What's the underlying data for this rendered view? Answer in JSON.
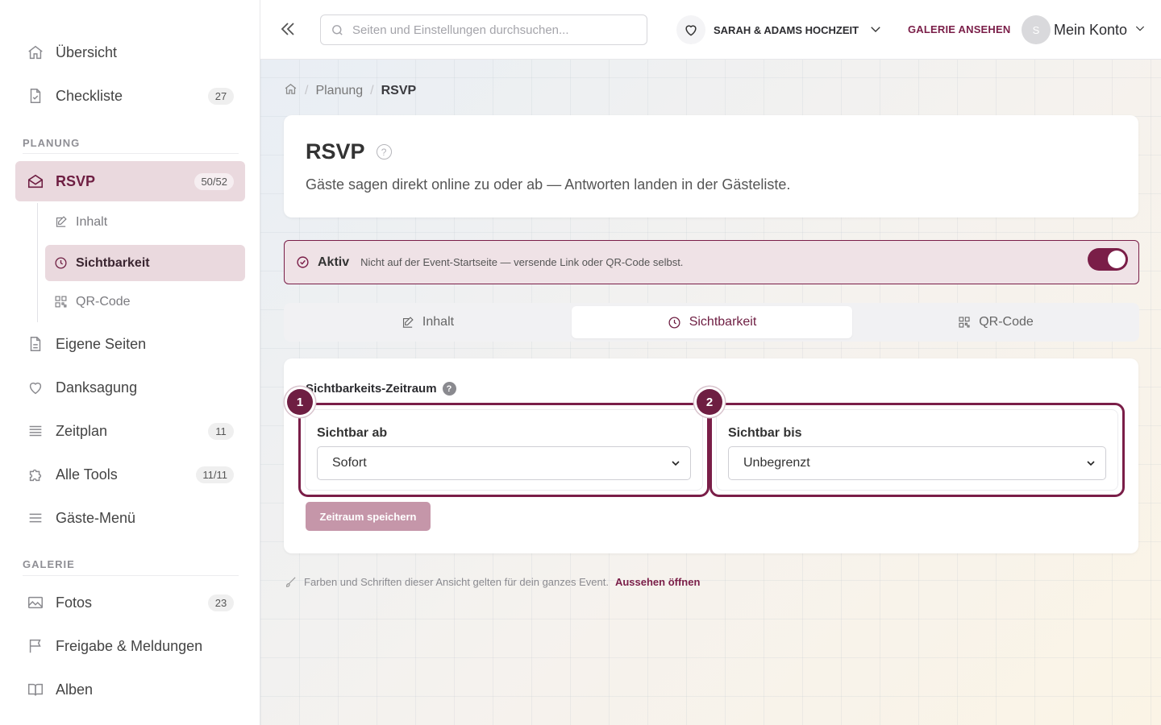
{
  "sidebar": {
    "overview": {
      "label": "Übersicht"
    },
    "checklist": {
      "label": "Checkliste",
      "badge": "27"
    },
    "section_planning": "PLANUNG",
    "rsvp": {
      "label": "RSVP",
      "badge": "50/52"
    },
    "rsvp_sub": {
      "content": "Inhalt",
      "visibility": "Sichtbarkeit",
      "qrcode": "QR-Code"
    },
    "custom_pages": {
      "label": "Eigene Seiten"
    },
    "thanks": {
      "label": "Danksagung"
    },
    "schedule": {
      "label": "Zeitplan",
      "badge": "11"
    },
    "all_tools": {
      "label": "Alle Tools",
      "badge": "11/11"
    },
    "guest_menu": {
      "label": "Gäste-Menü"
    },
    "section_gallery": "GALERIE",
    "photos": {
      "label": "Fotos",
      "badge": "23"
    },
    "approval": {
      "label": "Freigabe & Meldungen"
    },
    "albums": {
      "label": "Alben"
    }
  },
  "topbar": {
    "search_placeholder": "Seiten und Einstellungen durchsuchen...",
    "event_name": "SARAH & ADAMS HOCHZEIT",
    "gallery_link": "GALERIE ANSEHEN",
    "avatar_initial": "S",
    "account_label": "Mein Konto"
  },
  "breadcrumb": {
    "level1": "Planung",
    "current": "RSVP"
  },
  "header": {
    "title": "RSVP",
    "description": "Gäste sagen direkt online zu oder ab — Antworten landen in der Gästeliste."
  },
  "status": {
    "label": "Aktiv",
    "text": "Nicht auf der Event-Startseite — versende Link oder QR-Code selbst.",
    "enabled": true
  },
  "tabs": {
    "content": "Inhalt",
    "visibility": "Sichtbarkeit",
    "qrcode": "QR-Code"
  },
  "visibility": {
    "section_title": "Sichtbarkeits-Zeitraum",
    "help": "?",
    "from": {
      "step": "1",
      "label": "Sichtbar ab",
      "value": "Sofort"
    },
    "until": {
      "step": "2",
      "label": "Sichtbar bis",
      "value": "Unbegrenzt"
    },
    "save_label": "Zeitraum speichern"
  },
  "footer": {
    "note": "Farben und Schriften dieser Ansicht gelten für dein ganzes Event.",
    "link": "Aussehen öffnen"
  },
  "colors": {
    "accent": "#7a1e48",
    "active_bg": "#ead9de"
  }
}
